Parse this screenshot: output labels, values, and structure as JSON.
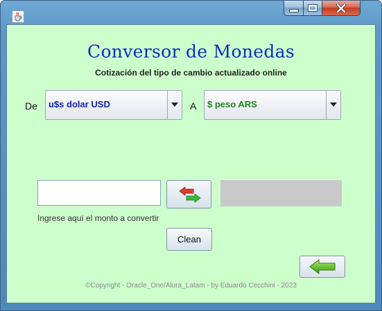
{
  "window": {
    "title": "",
    "icon": "java-cup-icon",
    "controls": [
      "minimize-icon",
      "maximize-icon",
      "close-icon"
    ]
  },
  "app": {
    "title": "Conversor de Monedas",
    "subtitle": "Cotización del tipo de cambio actualizado online"
  },
  "from": {
    "label": "De",
    "selected": "u$s dolar USD",
    "color": "#1020c0"
  },
  "to": {
    "label": "A",
    "selected": "$ peso ARS",
    "color": "#1a8a1a"
  },
  "amount": {
    "value": "",
    "hint": "Ingrese aquí el monto a convertir"
  },
  "result": {
    "value": ""
  },
  "buttons": {
    "swap_icon": "swap-arrows-icon",
    "clean_label": "Clean",
    "back_icon": "back-arrow-icon"
  },
  "footer": {
    "text": "©Copyright - Oracle_One/Alura_Latam  - by Eduardo Cecchini - 2023"
  },
  "colors": {
    "background": "#ccffcc",
    "title": "#0a2fc0",
    "result_box": "#c9c9c9"
  }
}
